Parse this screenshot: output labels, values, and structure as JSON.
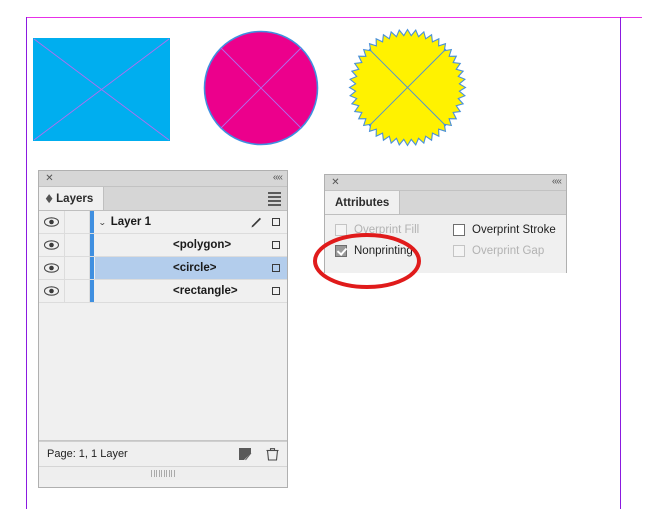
{
  "app": {
    "artboard": {
      "border_color_top": "#e830e8",
      "border_color_side": "#8b1ae0"
    },
    "shapes": [
      {
        "name": "rectangle",
        "type": "rectangle",
        "fill": "#00AEEF",
        "stroke": "#00AEEF",
        "nonprinting_cross_color": "#b06ef0"
      },
      {
        "name": "circle",
        "type": "circle",
        "fill": "#EC008C",
        "stroke": "#3f8fe0",
        "nonprinting_cross_color": "#b06ef0"
      },
      {
        "name": "polygon",
        "type": "starburst",
        "fill": "#FFF200",
        "stroke": "#4a90d9",
        "points": 44,
        "nonprinting_cross_color": "#4a90d9"
      }
    ]
  },
  "layers_panel": {
    "close_icon": "✕",
    "collapse_icon": "««",
    "tab_label": "Layers",
    "tab_sort_icon": "⌃⌄",
    "menu_icon": "hamburger-menu-icon",
    "column_icons": {
      "visibility": "eye-icon",
      "edit": "pencil-icon",
      "target": "target-square-icon"
    },
    "rows": [
      {
        "label": "Layer 1",
        "type": "layer",
        "visible": true,
        "expanded": true,
        "disclosure": "⌄",
        "selected": false,
        "has_pencil": true,
        "color": "#3f8fe0"
      },
      {
        "label": "<polygon>",
        "type": "object",
        "visible": true,
        "selected": false,
        "has_pencil": false,
        "color": "#3f8fe0"
      },
      {
        "label": "<circle>",
        "type": "object",
        "visible": true,
        "selected": true,
        "has_pencil": false,
        "color": "#3f8fe0"
      },
      {
        "label": "<rectangle>",
        "type": "object",
        "visible": true,
        "selected": false,
        "has_pencil": false,
        "color": "#3f8fe0"
      }
    ],
    "footer": {
      "status": "Page: 1, 1 Layer",
      "new_layer_icon": "new-layer-icon",
      "delete_icon": "trash-icon"
    },
    "selection_color": "#b3cdec"
  },
  "attributes_panel": {
    "close_icon": "✕",
    "collapse_icon": "««",
    "tab_label": "Attributes",
    "options": [
      {
        "label": "Overprint Fill",
        "checked": false,
        "enabled": false
      },
      {
        "label": "Overprint Stroke",
        "checked": false,
        "enabled": true
      },
      {
        "label": "Nonprinting",
        "checked": true,
        "enabled": true
      },
      {
        "label": "Overprint Gap",
        "checked": false,
        "enabled": false
      }
    ]
  },
  "annotation": {
    "shape": "ellipse",
    "color": "#e01b1b",
    "target": "Nonprinting"
  }
}
